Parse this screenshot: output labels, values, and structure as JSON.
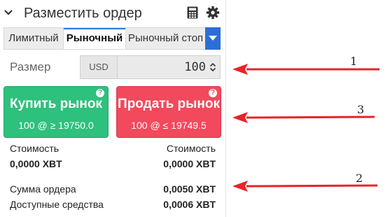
{
  "header": {
    "title": "Разместить ордер",
    "calculator_icon": "calculator-icon",
    "settings_icon": "gear-icon",
    "collapse_icon": "chevron-down-icon"
  },
  "order_type_tabs": {
    "items": [
      {
        "label": "Лимитный",
        "active": false
      },
      {
        "label": "Рыночный",
        "active": true
      },
      {
        "label": "Рыночный стоп",
        "active": false
      }
    ],
    "dropdown_icon": "caret-down-icon"
  },
  "size": {
    "label": "Размер",
    "currency": "USD",
    "value": "100"
  },
  "buy_button": {
    "label": "Купить рынок",
    "detail": "100 @ ≥ 19750.0",
    "color": "#2ec07d"
  },
  "sell_button": {
    "label": "Продать рынок",
    "detail": "100 @ ≤ 19749.5",
    "color": "#f2495c"
  },
  "cost": {
    "buy_label": "Стоимость",
    "buy_value": "0,0000 XBT",
    "sell_label": "Стоимость",
    "sell_value": "0,0000 XBT"
  },
  "summary": {
    "order_value_label": "Сумма ордера",
    "order_value": "0,0050 XBT",
    "available_label": "Доступные средства",
    "available_value": "0,0006 XBT"
  },
  "annotations": [
    {
      "number": "1",
      "color": "#e8232a"
    },
    {
      "number": "3",
      "color": "#e8232a"
    },
    {
      "number": "2",
      "color": "#e8232a"
    }
  ]
}
